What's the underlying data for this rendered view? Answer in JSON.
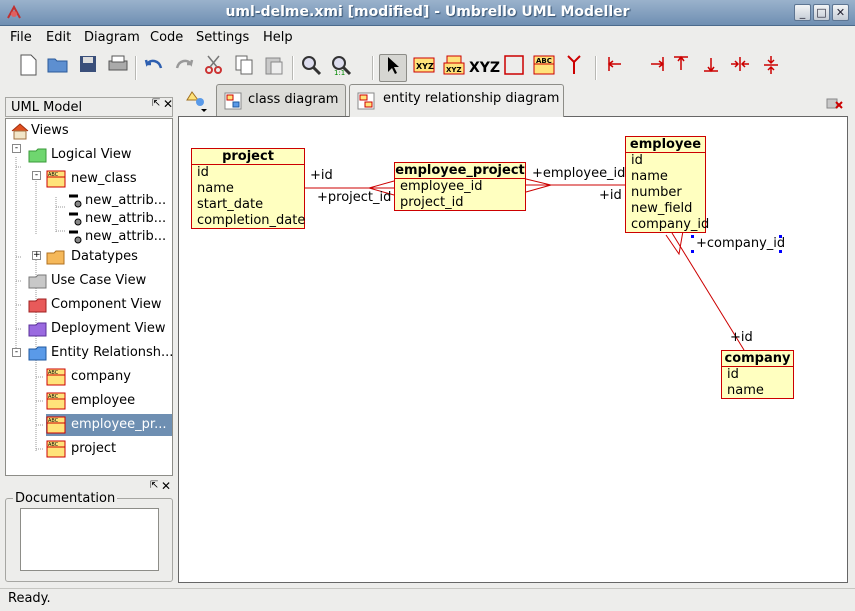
{
  "window": {
    "title": "uml-delme.xmi [modified] - Umbrello UML Modeller"
  },
  "menu": [
    "File",
    "Edit",
    "Diagram",
    "Code",
    "Settings",
    "Help"
  ],
  "toolbar": {
    "xyz_label": "XYZ"
  },
  "tree_panel": {
    "title": "UML Model",
    "items": [
      {
        "label": "Views"
      },
      {
        "label": "Logical View"
      },
      {
        "label": "new_class"
      },
      {
        "label": "new_attrib..."
      },
      {
        "label": "new_attrib..."
      },
      {
        "label": "new_attrib..."
      },
      {
        "label": "Datatypes"
      },
      {
        "label": "Use Case View"
      },
      {
        "label": "Component View"
      },
      {
        "label": "Deployment View"
      },
      {
        "label": "Entity Relationsh..."
      },
      {
        "label": "company"
      },
      {
        "label": "employee"
      },
      {
        "label": "employee_pr..."
      },
      {
        "label": "project"
      }
    ]
  },
  "doc_panel": {
    "title": "Documentation"
  },
  "tabs": [
    {
      "label": "class diagram"
    },
    {
      "label": "entity relationship diagram"
    }
  ],
  "diagram": {
    "entities": {
      "project": {
        "name": "project",
        "fields": [
          "id",
          "name",
          "start_date",
          "completion_date"
        ]
      },
      "employee_project": {
        "name": "employee_project",
        "fields": [
          "employee_id",
          "project_id"
        ]
      },
      "employee": {
        "name": "employee",
        "fields": [
          "id",
          "name",
          "number",
          "new_field",
          "company_id"
        ]
      },
      "company": {
        "name": "company",
        "fields": [
          "id",
          "name"
        ]
      }
    },
    "labels": {
      "l1": "+id",
      "l2": "+project_id",
      "l3": "+employee_id",
      "l4": "+id",
      "l5": "+company_id",
      "l6": "+id"
    }
  },
  "status": {
    "text": "Ready."
  },
  "colors": {
    "entity_fill": "#ffffc0",
    "entity_border": "#cc0000",
    "selection": "#6e8fb2"
  }
}
